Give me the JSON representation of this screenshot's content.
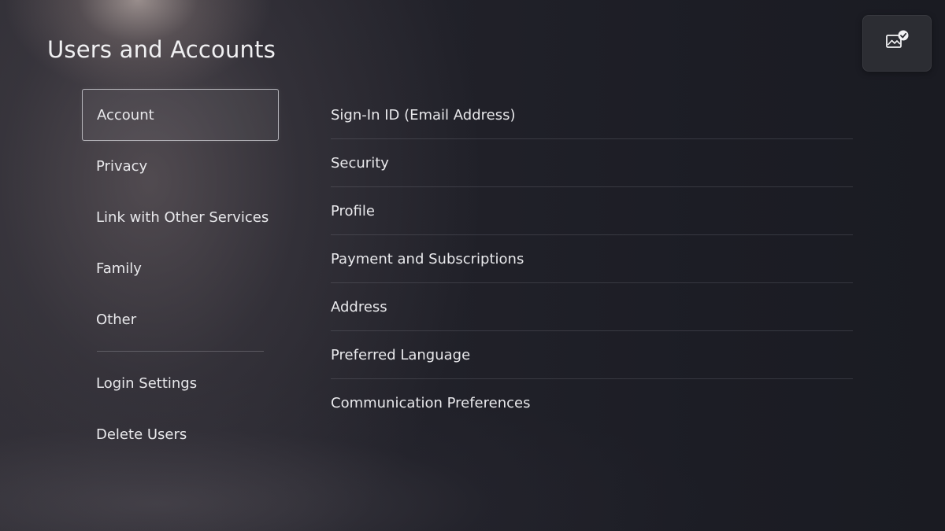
{
  "header": {
    "title": "Users and Accounts"
  },
  "capture_widget": {
    "icon": "image-check-icon"
  },
  "side_menu": {
    "selected": "Account",
    "items": [
      {
        "label": "Account"
      },
      {
        "label": "Privacy"
      },
      {
        "label": "Link with Other Services"
      },
      {
        "label": "Family"
      },
      {
        "label": "Other"
      },
      {
        "label": "Login Settings"
      },
      {
        "label": "Delete Users"
      }
    ]
  },
  "detail_list": {
    "items": [
      {
        "label": "Sign-In ID (Email Address)"
      },
      {
        "label": "Security"
      },
      {
        "label": "Profile"
      },
      {
        "label": "Payment and Subscriptions"
      },
      {
        "label": "Address"
      },
      {
        "label": "Preferred Language"
      },
      {
        "label": "Communication Preferences"
      }
    ]
  },
  "colors": {
    "background": "#1d1e26",
    "text": "#e9e9ec",
    "focus_border": "#dcdce2"
  }
}
